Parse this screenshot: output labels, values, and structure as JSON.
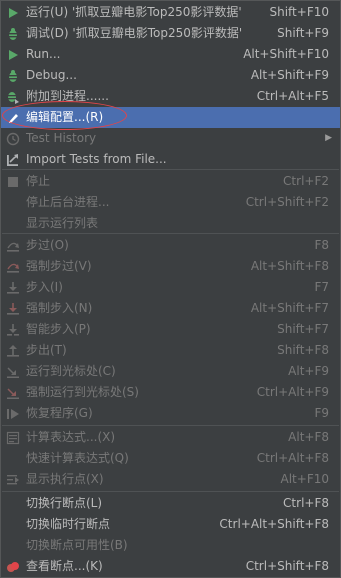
{
  "menu": {
    "items": [
      {
        "label": "运行(U) '抓取豆瓣电影Top250影评数据'",
        "shortcut": "Shift+F10",
        "icon": "run-icon",
        "disabled": false
      },
      {
        "label": "调试(D) '抓取豆瓣电影Top250影评数据'",
        "shortcut": "Shift+F9",
        "icon": "debug-icon",
        "disabled": false
      },
      {
        "label": "Run...",
        "shortcut": "Alt+Shift+F10",
        "icon": "run-icon",
        "disabled": false
      },
      {
        "label": "Debug...",
        "shortcut": "Alt+Shift+F9",
        "icon": "debug-icon",
        "disabled": false
      },
      {
        "label": "附加到进程......",
        "shortcut": "Ctrl+Alt+F5",
        "icon": "attach-icon",
        "disabled": false
      },
      {
        "label": "编辑配置...(R)",
        "shortcut": "",
        "icon": "edit-config-icon",
        "disabled": false,
        "selected": true
      },
      {
        "label": "Test History",
        "shortcut": "",
        "icon": "history-icon",
        "disabled": true,
        "submenu": true
      },
      {
        "label": "Import Tests from File...",
        "shortcut": "",
        "icon": "import-tests-icon",
        "disabled": false
      },
      {
        "label": "停止",
        "shortcut": "Ctrl+F2",
        "icon": "stop-icon",
        "disabled": true
      },
      {
        "label": "停止后台进程...",
        "shortcut": "Ctrl+Shift+F2",
        "icon": "",
        "disabled": true
      },
      {
        "label": "显示运行列表",
        "shortcut": "",
        "icon": "",
        "disabled": true
      },
      {
        "label": "步过(O)",
        "shortcut": "F8",
        "icon": "step-over-icon",
        "disabled": true
      },
      {
        "label": "强制步过(V)",
        "shortcut": "Alt+Shift+F8",
        "icon": "force-step-over-icon",
        "disabled": true
      },
      {
        "label": "步入(I)",
        "shortcut": "F7",
        "icon": "step-into-icon",
        "disabled": true
      },
      {
        "label": "强制步入(N)",
        "shortcut": "Alt+Shift+F7",
        "icon": "force-step-into-icon",
        "disabled": true
      },
      {
        "label": "智能步入(P)",
        "shortcut": "Shift+F7",
        "icon": "smart-step-into-icon",
        "disabled": true
      },
      {
        "label": "步出(T)",
        "shortcut": "Shift+F8",
        "icon": "step-out-icon",
        "disabled": true
      },
      {
        "label": "运行到光标处(C)",
        "shortcut": "Alt+F9",
        "icon": "run-to-cursor-icon",
        "disabled": true
      },
      {
        "label": "强制运行到光标处(S)",
        "shortcut": "Ctrl+Alt+F9",
        "icon": "force-run-to-cursor-icon",
        "disabled": true
      },
      {
        "label": "恢复程序(G)",
        "shortcut": "F9",
        "icon": "resume-icon",
        "disabled": true
      },
      {
        "label": "计算表达式...(X)",
        "shortcut": "Alt+F8",
        "icon": "evaluate-icon",
        "disabled": true
      },
      {
        "label": "快速计算表达式(Q)",
        "shortcut": "Ctrl+Alt+F8",
        "icon": "",
        "disabled": true
      },
      {
        "label": "显示执行点(X)",
        "shortcut": "Alt+F10",
        "icon": "show-execution-point-icon",
        "disabled": true
      },
      {
        "label": "切换行断点(L)",
        "shortcut": "Ctrl+F8",
        "icon": "",
        "disabled": false
      },
      {
        "label": "切换临时行断点",
        "shortcut": "Ctrl+Alt+Shift+F8",
        "icon": "",
        "disabled": false
      },
      {
        "label": "切换断点可用性(B)",
        "shortcut": "",
        "icon": "",
        "disabled": true
      },
      {
        "label": "查看断点...(K)",
        "shortcut": "Ctrl+Shift+F8",
        "icon": "breakpoints-icon",
        "disabled": false
      }
    ]
  },
  "colors": {
    "background": "#3c3f41",
    "selection": "#4b6eaf",
    "text": "#bbbbbb",
    "disabled_text": "#787878",
    "run_green": "#59a869",
    "annotation_red": "#e0454a"
  }
}
